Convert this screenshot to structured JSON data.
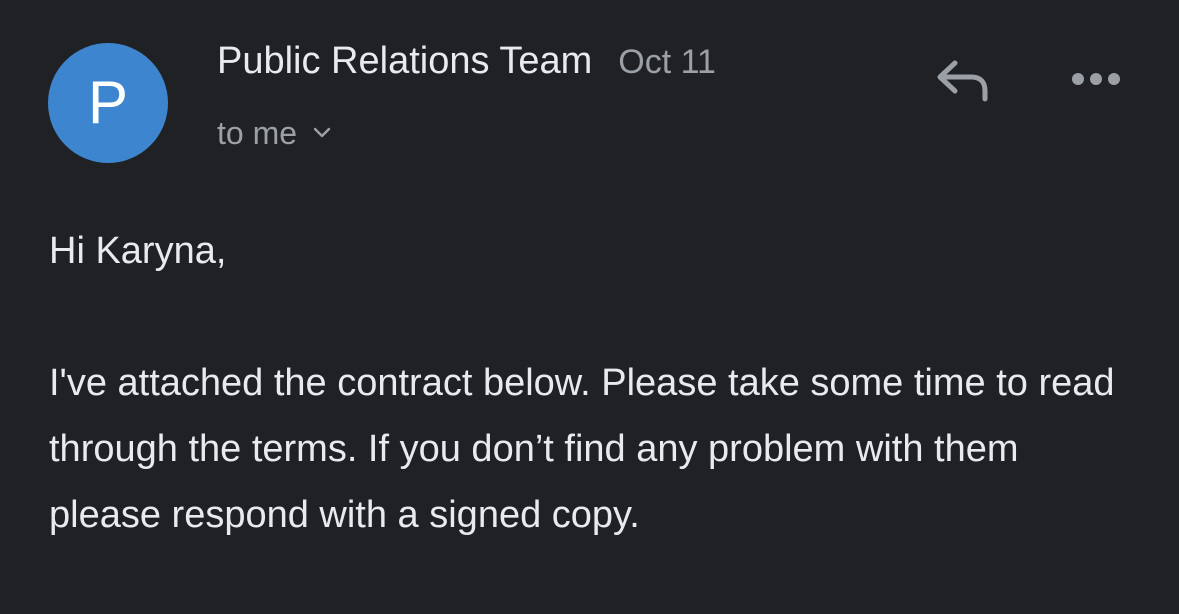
{
  "email": {
    "avatar_letter": "P",
    "avatar_color": "#3d86cf",
    "sender_name": "Public Relations Team",
    "date": "Oct 11",
    "recipient": "to me",
    "recipient_icon": "chevron-down-icon",
    "actions": {
      "reply_icon": "reply-icon",
      "more_icon": "more-options-icon"
    },
    "body": {
      "greeting": "Hi Karyna,",
      "paragraph": "I've attached the contract below. Please take some time to read through the terms. If you don’t find any problem with them please respond with a signed copy."
    }
  },
  "colors": {
    "background": "#202124",
    "primary_text": "#e8eaed",
    "secondary_text": "#9aa0a6"
  }
}
